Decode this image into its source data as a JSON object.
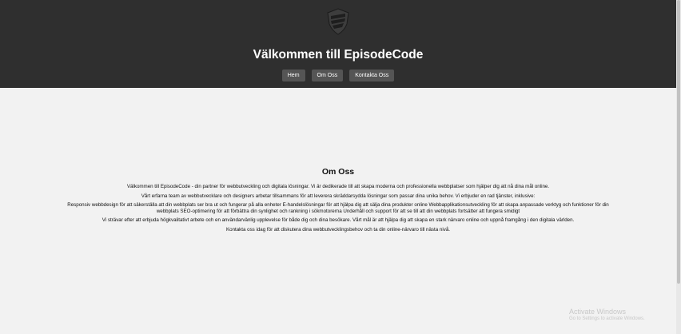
{
  "header": {
    "logo_icon": "shield-logo-icon",
    "title": "Välkommen till EpisodeCode",
    "nav": [
      {
        "label": "Hem"
      },
      {
        "label": "Om Oss"
      },
      {
        "label": "Kontakta Oss"
      }
    ],
    "bg_color": "#2f2f2f",
    "button_color": "#555555"
  },
  "about": {
    "heading": "Om Oss",
    "paragraphs": [
      "Välkommen till EpisodeCode - din partner för webbutveckling och digitala lösningar. Vi är dedikerade till att skapa moderna och professionella webbplatser som hjälper dig att nå dina mål online.",
      "Vårt erfarna team av webbutvecklare och designers arbetar tillsammans för att leverera skräddarsydda lösningar som passar dina unika behov. Vi erbjuder en rad tjänster, inklusive:",
      "Responsiv webbdesign för att säkerställa att din webbplats ser bra ut och fungerar på alla enheter E-handelslösningar för att hjälpa dig att sälja dina produkter online Webbapplikationsutveckling för att skapa anpassade verktyg och funktioner för din webbplats SEO-optimering för att förbättra din synlighet och rankning i sökmotorerna Underhåll och support för att se till att din webbplats fortsätter att fungera smidigt",
      "Vi strävar efter att erbjuda högkvalitativt arbete och en användarvänlig upplevelse för både dig och dina besökare. Vårt mål är att hjälpa dig att skapa en stark närvaro online och uppnå framgång i den digitala världen.",
      "Kontakta oss idag för att diskutera dina webbutvecklingsbehov och ta din online-närvaro till nästa nivå."
    ]
  },
  "watermark": {
    "title": "Activate Windows",
    "subtitle": "Go to Settings to activate Windows."
  }
}
